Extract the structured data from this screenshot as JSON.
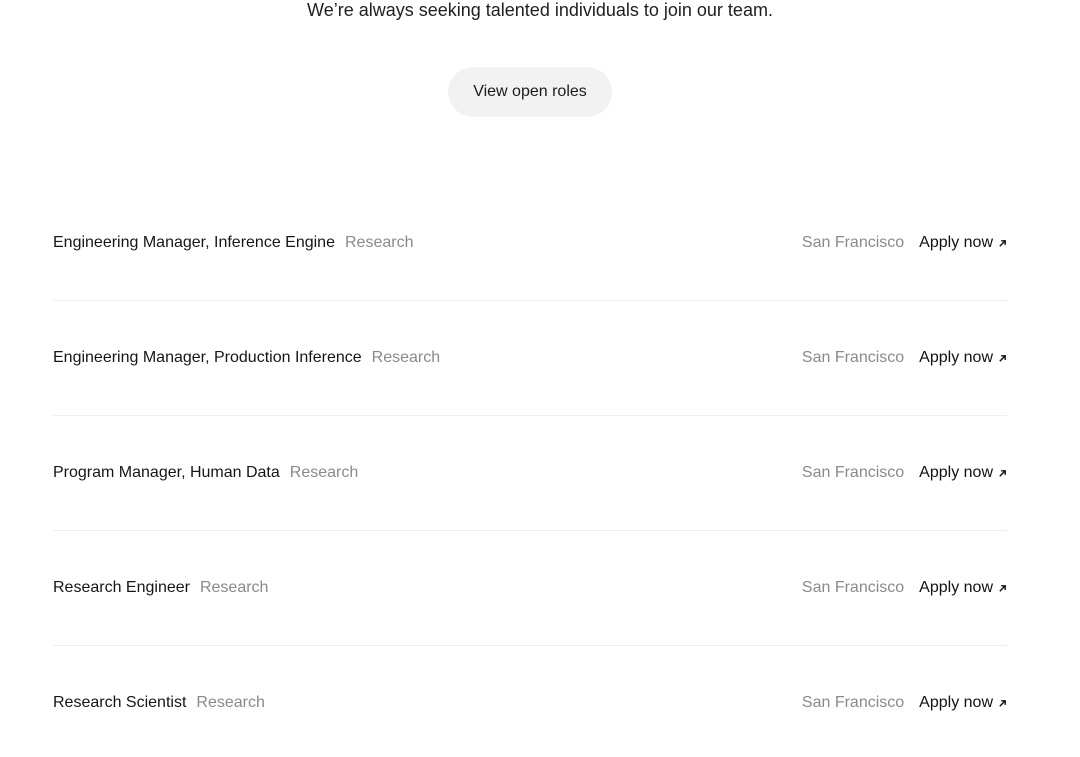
{
  "intro": {
    "text": "We’re always seeking talented individuals to join our team."
  },
  "cta": {
    "label": "View open roles"
  },
  "roles": [
    {
      "title": "Engineering Manager, Inference Engine",
      "department": "Research",
      "location": "San Francisco",
      "apply_label": "Apply now"
    },
    {
      "title": "Engineering Manager, Production Inference",
      "department": "Research",
      "location": "San Francisco",
      "apply_label": "Apply now"
    },
    {
      "title": "Program Manager, Human Data",
      "department": "Research",
      "location": "San Francisco",
      "apply_label": "Apply now"
    },
    {
      "title": "Research Engineer",
      "department": "Research",
      "location": "San Francisco",
      "apply_label": "Apply now"
    },
    {
      "title": "Research Scientist",
      "department": "Research",
      "location": "San Francisco",
      "apply_label": "Apply now"
    }
  ],
  "icons": {
    "apply": "arrow-up-right-icon"
  }
}
